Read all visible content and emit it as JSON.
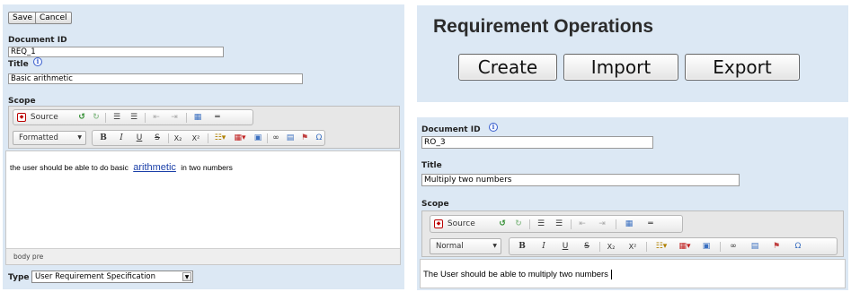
{
  "left_form": {
    "buttons": {
      "save": "Save",
      "cancel": "Cancel"
    },
    "document_id": {
      "label": "Document ID",
      "value": "REQ_1"
    },
    "title": {
      "label": "Title",
      "value": "Basic arithmetic"
    },
    "scope": {
      "label": "Scope"
    },
    "toolbar": {
      "source_label": "Source",
      "format_label": "Formatted",
      "bold": "B",
      "italic": "I",
      "underline": "U",
      "strike": "S",
      "subscript": "X₂",
      "superscript": "X²",
      "omega": "Ω"
    },
    "editor": {
      "text_before": "the user should be able to do basic",
      "link_text": "arithmetic",
      "text_after": "in  two numbers"
    },
    "status_path": "body  pre",
    "type": {
      "label": "Type",
      "value": "User Requirement Specification"
    }
  },
  "operations": {
    "heading": "Requirement Operations",
    "create": "Create",
    "import": "Import",
    "export": "Export"
  },
  "right_form": {
    "document_id": {
      "label": "Document ID",
      "value": "RO_3"
    },
    "title": {
      "label": "Title",
      "value": "Multiply  two numbers"
    },
    "scope": {
      "label": "Scope"
    },
    "toolbar": {
      "source_label": "Source",
      "format_label": "Normal",
      "bold": "B",
      "italic": "I",
      "underline": "U",
      "strike": "S",
      "subscript": "X₂",
      "superscript": "X²",
      "omega": "Ω"
    },
    "editor_text": "The User should be able to multiply two numbers"
  },
  "colors": {
    "panel_bg": "#dce8f4",
    "link": "#1a3fa8",
    "info_icon": "#3a5fcd"
  },
  "icons": [
    "info-icon",
    "source-icon",
    "undo-icon",
    "redo-icon",
    "numbered-list-icon",
    "bullet-list-icon",
    "outdent-icon",
    "indent-icon",
    "table-icon",
    "horizontal-rule-icon",
    "color-icon",
    "table-insert-icon",
    "image-icon",
    "link-icon",
    "anchor-icon",
    "flag-icon",
    "omega-icon"
  ]
}
